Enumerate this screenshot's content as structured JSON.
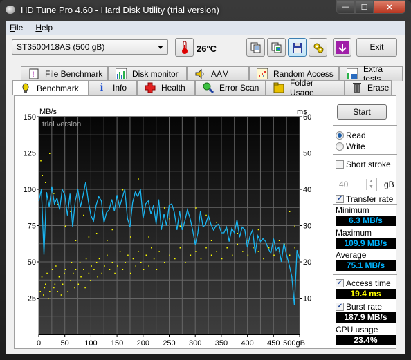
{
  "window": {
    "title": "HD Tune Pro 4.60 - Hard Disk Utility (trial version)",
    "controls": {
      "minimize": "—",
      "maximize": "☐",
      "close": "✕"
    }
  },
  "menu": [
    {
      "label": "File",
      "accel": "F",
      "rest": "ile"
    },
    {
      "label": "Help",
      "accel": "H",
      "rest": "elp"
    }
  ],
  "toolbar": {
    "drive": "ST3500418AS (500 gB)",
    "temperature": "26°C",
    "icons": [
      "copy-info-icon",
      "copy-screenshot-icon",
      "save-icon",
      "options-icon",
      "download-icon"
    ],
    "exit_label": "Exit"
  },
  "tabs": {
    "row1": [
      {
        "label": "File Benchmark",
        "icon": "file-benchmark-icon"
      },
      {
        "label": "Disk monitor",
        "icon": "disk-monitor-icon"
      },
      {
        "label": "AAM",
        "icon": "speaker-icon"
      },
      {
        "label": "Random Access",
        "icon": "random-access-icon"
      },
      {
        "label": "Extra tests",
        "icon": "extra-tests-icon"
      }
    ],
    "row2": [
      {
        "label": "Benchmark",
        "icon": "benchmark-icon",
        "selected": true
      },
      {
        "label": "Info",
        "icon": "info-icon"
      },
      {
        "label": "Health",
        "icon": "health-icon"
      },
      {
        "label": "Error Scan",
        "icon": "error-scan-icon"
      },
      {
        "label": "Folder Usage",
        "icon": "folder-icon"
      },
      {
        "label": "Erase",
        "icon": "trash-icon"
      }
    ]
  },
  "side": {
    "start_label": "Start",
    "read_label": "Read",
    "write_label": "Write",
    "mode": "Read",
    "short_stroke_label": "Short stroke",
    "short_stroke_checked": false,
    "short_stroke_value": "40",
    "short_stroke_unit": "gB",
    "transfer_rate_label": "Transfer rate",
    "transfer_rate_checked": true,
    "minimum_label": "Minimum",
    "minimum_value": "6.3 MB/s",
    "maximum_label": "Maximum",
    "maximum_value": "109.9 MB/s",
    "average_label": "Average",
    "average_value": "75.1 MB/s",
    "access_time_label": "Access time",
    "access_time_checked": true,
    "access_time_value": "19.4 ms",
    "burst_rate_label": "Burst rate",
    "burst_rate_checked": true,
    "burst_rate_value": "187.9 MB/s",
    "cpu_label": "CPU usage",
    "cpu_value": "23.4%"
  },
  "chart_data": {
    "type": "line",
    "watermark": "trial version",
    "left_axis_label": "MB/s",
    "right_axis_label": "ms",
    "xlabel_suffix": "gB",
    "xlim": [
      0,
      500
    ],
    "ylim_left": [
      0,
      150
    ],
    "ylim_right": [
      0,
      60
    ],
    "x_ticks": [
      "0",
      "50",
      "100",
      "150",
      "200",
      "250",
      "300",
      "350",
      "400",
      "450",
      "500gB"
    ],
    "y_ticks_left": [
      "25",
      "50",
      "75",
      "100",
      "125",
      "150"
    ],
    "y_ticks_right": [
      "10",
      "20",
      "30",
      "40",
      "50",
      "60"
    ],
    "grid": true,
    "series": [
      {
        "name": "Transfer rate (MB/s)",
        "color": "#19b4f0",
        "x": [
          0,
          5,
          10,
          15,
          20,
          25,
          30,
          35,
          40,
          45,
          50,
          55,
          60,
          65,
          70,
          75,
          80,
          85,
          90,
          95,
          100,
          105,
          110,
          115,
          120,
          125,
          130,
          135,
          140,
          145,
          150,
          155,
          160,
          165,
          170,
          175,
          180,
          185,
          190,
          195,
          200,
          205,
          210,
          215,
          220,
          225,
          230,
          235,
          240,
          245,
          250,
          255,
          260,
          265,
          270,
          275,
          280,
          285,
          290,
          295,
          300,
          305,
          310,
          315,
          320,
          325,
          330,
          335,
          340,
          345,
          350,
          355,
          360,
          365,
          370,
          375,
          380,
          385,
          390,
          395,
          400,
          405,
          410,
          415,
          420,
          425,
          430,
          435,
          440,
          445,
          450,
          455,
          460,
          465,
          470,
          475,
          480,
          485,
          490,
          495,
          500
        ],
        "values": [
          92,
          100,
          55,
          98,
          88,
          102,
          90,
          94,
          86,
          100,
          96,
          82,
          97,
          74,
          92,
          100,
          88,
          96,
          105,
          92,
          82,
          78,
          89,
          95,
          92,
          77,
          84,
          86,
          93,
          85,
          96,
          88,
          94,
          100,
          80,
          74,
          91,
          98,
          95,
          100,
          80,
          90,
          92,
          83,
          89,
          76,
          93,
          72,
          83,
          75,
          89,
          90,
          84,
          72,
          85,
          72,
          78,
          86,
          80,
          72,
          62,
          70,
          85,
          74,
          76,
          82,
          76,
          72,
          75,
          76,
          70,
          70,
          74,
          64,
          73,
          70,
          79,
          67,
          74,
          72,
          60,
          68,
          72,
          56,
          68,
          64,
          66,
          64,
          59,
          56,
          66,
          58,
          60,
          50,
          63,
          55,
          48,
          40,
          20,
          58,
          52
        ]
      },
      {
        "name": "Access time (ms)",
        "color": "#ffff00",
        "type": "scatter",
        "approx_trend": {
          "x": [
            0,
            100,
            200,
            300,
            400,
            500
          ],
          "values": [
            10,
            14,
            17,
            19,
            21,
            22
          ]
        },
        "outlier_range_ms": [
          25,
          50
        ],
        "points": [
          [
            2,
            12
          ],
          [
            5,
            16
          ],
          [
            8,
            11
          ],
          [
            10,
            13
          ],
          [
            12,
            14
          ],
          [
            15,
            17
          ],
          [
            18,
            10
          ],
          [
            20,
            12
          ],
          [
            22,
            15
          ],
          [
            25,
            18
          ],
          [
            28,
            13
          ],
          [
            30,
            14
          ],
          [
            32,
            19
          ],
          [
            35,
            12
          ],
          [
            38,
            16
          ],
          [
            40,
            15
          ],
          [
            42,
            11
          ],
          [
            45,
            14
          ],
          [
            48,
            17
          ],
          [
            50,
            18
          ],
          [
            55,
            12
          ],
          [
            60,
            15
          ],
          [
            62,
            20
          ],
          [
            65,
            17
          ],
          [
            68,
            13
          ],
          [
            70,
            18
          ],
          [
            75,
            14
          ],
          [
            78,
            20
          ],
          [
            80,
            16
          ],
          [
            85,
            18
          ],
          [
            88,
            13
          ],
          [
            90,
            21
          ],
          [
            95,
            17
          ],
          [
            98,
            15
          ],
          [
            100,
            19
          ],
          [
            105,
            18
          ],
          [
            110,
            20
          ],
          [
            112,
            16
          ],
          [
            115,
            21
          ],
          [
            120,
            17
          ],
          [
            125,
            19
          ],
          [
            130,
            22
          ],
          [
            135,
            18
          ],
          [
            140,
            20
          ],
          [
            145,
            17
          ],
          [
            150,
            19
          ],
          [
            155,
            23
          ],
          [
            160,
            18
          ],
          [
            165,
            20
          ],
          [
            170,
            22
          ],
          [
            175,
            17
          ],
          [
            180,
            21
          ],
          [
            185,
            19
          ],
          [
            190,
            23
          ],
          [
            195,
            20
          ],
          [
            200,
            18
          ],
          [
            205,
            22
          ],
          [
            210,
            19
          ],
          [
            215,
            24
          ],
          [
            220,
            21
          ],
          [
            225,
            18
          ],
          [
            230,
            23
          ],
          [
            240,
            20
          ],
          [
            250,
            22
          ],
          [
            260,
            21
          ],
          [
            270,
            24
          ],
          [
            280,
            20
          ],
          [
            290,
            22
          ],
          [
            300,
            23
          ],
          [
            310,
            21
          ],
          [
            320,
            24
          ],
          [
            330,
            22
          ],
          [
            340,
            23
          ],
          [
            350,
            21
          ],
          [
            360,
            24
          ],
          [
            370,
            22
          ],
          [
            380,
            25
          ],
          [
            390,
            23
          ],
          [
            400,
            22
          ],
          [
            410,
            24
          ],
          [
            420,
            23
          ],
          [
            430,
            21
          ],
          [
            440,
            24
          ],
          [
            450,
            22
          ],
          [
            460,
            23
          ],
          [
            470,
            25
          ],
          [
            480,
            22
          ],
          [
            490,
            24
          ],
          [
            495,
            23
          ],
          [
            3,
            48
          ],
          [
            6,
            44
          ],
          [
            20,
            50
          ],
          [
            35,
            36
          ],
          [
            50,
            30
          ],
          [
            60,
            34
          ],
          [
            85,
            33
          ],
          [
            110,
            28
          ],
          [
            140,
            29
          ],
          [
            160,
            40
          ],
          [
            190,
            43
          ],
          [
            240,
            35
          ],
          [
            250,
            32
          ],
          [
            300,
            35
          ],
          [
            320,
            33
          ],
          [
            340,
            31
          ],
          [
            360,
            29
          ],
          [
            380,
            28
          ],
          [
            400,
            26
          ],
          [
            420,
            29
          ],
          [
            440,
            24
          ],
          [
            460,
            26
          ],
          [
            480,
            34
          ],
          [
            490,
            30
          ],
          [
            12,
            42
          ],
          [
            28,
            39
          ],
          [
            70,
            26
          ],
          [
            95,
            27
          ],
          [
            130,
            26
          ],
          [
            175,
            27
          ],
          [
            210,
            27
          ],
          [
            270,
            30
          ],
          [
            330,
            26
          ],
          [
            410,
            27
          ]
        ]
      }
    ]
  }
}
